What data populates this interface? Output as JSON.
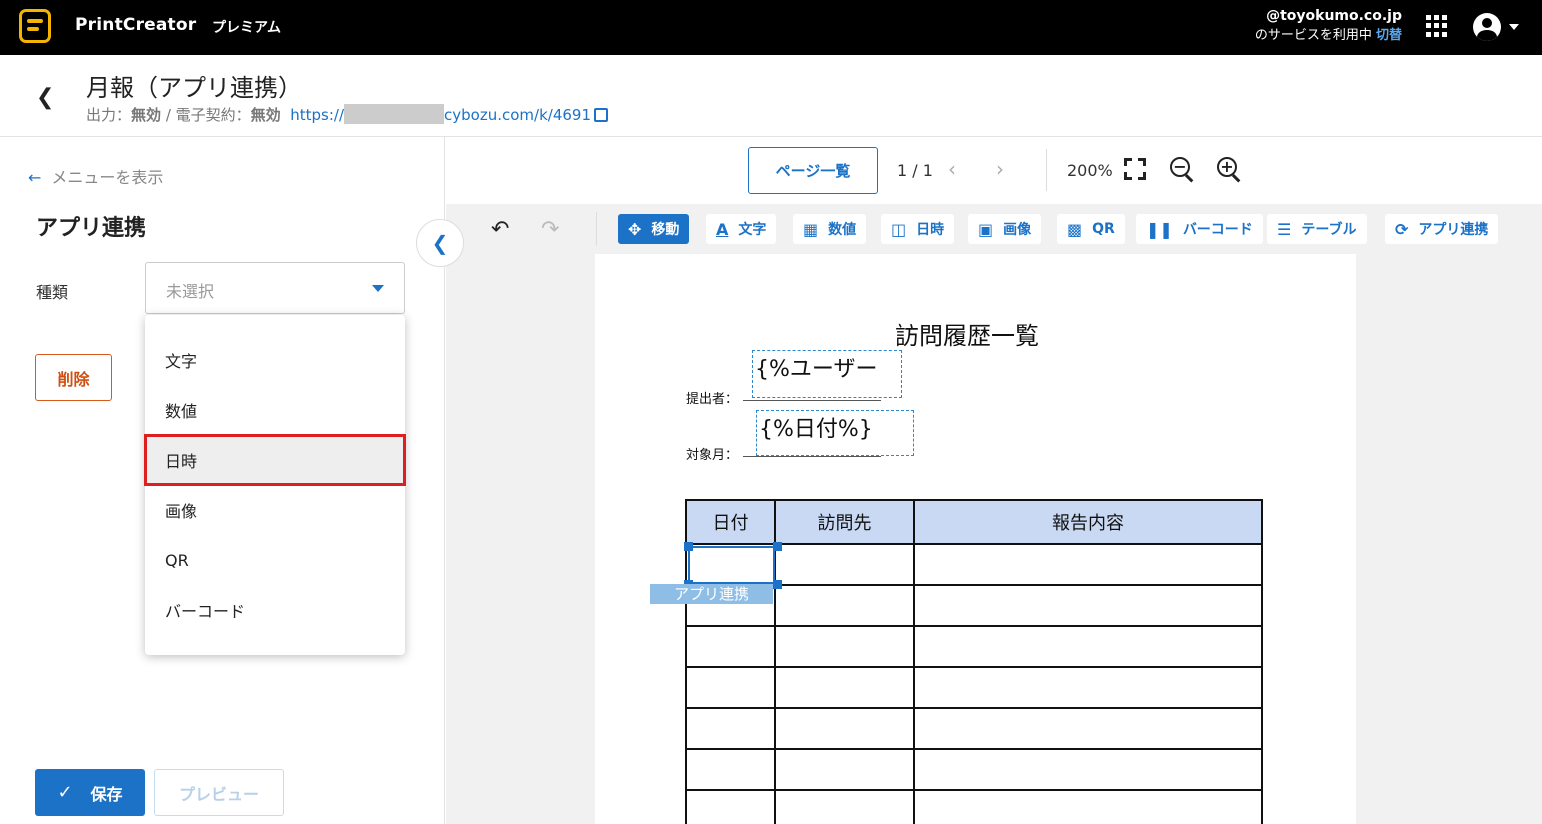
{
  "header": {
    "brand": "PrintCreator",
    "plan": "プレミアム",
    "account_email": "@toyokumo.co.jp",
    "account_service": "のサービスを利用中",
    "switch_label": "切替",
    "apps_icon": "apps-grid-icon",
    "user_icon": "account-circle-icon"
  },
  "subheader": {
    "title": "月報（アプリ連携）",
    "output_label": "出力：",
    "output_value": "無効",
    "contract_label": "電子契約：",
    "contract_value": "無効",
    "separator": "/",
    "url_prefix": "https://",
    "url_suffix": "cybozu.com/k/4691"
  },
  "left_panel": {
    "show_menu": "メニューを表示",
    "section_title": "アプリ連携",
    "kind_label": "種類",
    "kind_placeholder": "未選択",
    "delete_button": "削除",
    "save_button": "保存",
    "preview_button": "プレビュー",
    "dropdown_options": [
      "文字",
      "数値",
      "日時",
      "画像",
      "QR",
      "バーコード"
    ],
    "dropdown_highlighted": "日時"
  },
  "pagebar": {
    "pages_button": "ページ一覧",
    "page_indicator": "1 / 1",
    "zoom": "200%"
  },
  "toolbar": {
    "tools": [
      {
        "label": "移動",
        "icon": "move-icon",
        "active": true
      },
      {
        "label": "文字",
        "icon": "text-icon",
        "active": false
      },
      {
        "label": "数値",
        "icon": "calculator-icon",
        "active": false
      },
      {
        "label": "日時",
        "icon": "calendar-icon",
        "active": false
      },
      {
        "label": "画像",
        "icon": "image-icon",
        "active": false
      },
      {
        "label": "QR",
        "icon": "qr-icon",
        "active": false
      },
      {
        "label": "バーコード",
        "icon": "barcode-icon",
        "active": false
      },
      {
        "label": "テーブル",
        "icon": "list-icon",
        "active": false
      },
      {
        "label": "アプリ連携",
        "icon": "sync-icon",
        "active": false
      }
    ]
  },
  "document": {
    "title": "訪問履歴一覧",
    "submitter_label": "提出者：",
    "submitter_placeholder": "{%ユーザー",
    "month_label": "対象月：",
    "month_placeholder": "{%日付%}",
    "table_headers": [
      "日付",
      "訪問先",
      "報告内容"
    ],
    "table_body_rows": 7,
    "app_tag": "アプリ連携"
  },
  "colors": {
    "accent": "#1c72c7",
    "topbar": "#000000",
    "brand_logo": "#f5b400",
    "delete": "#d05010",
    "highlight_border": "#dd1f1f",
    "table_header": "#c9d9f4"
  }
}
